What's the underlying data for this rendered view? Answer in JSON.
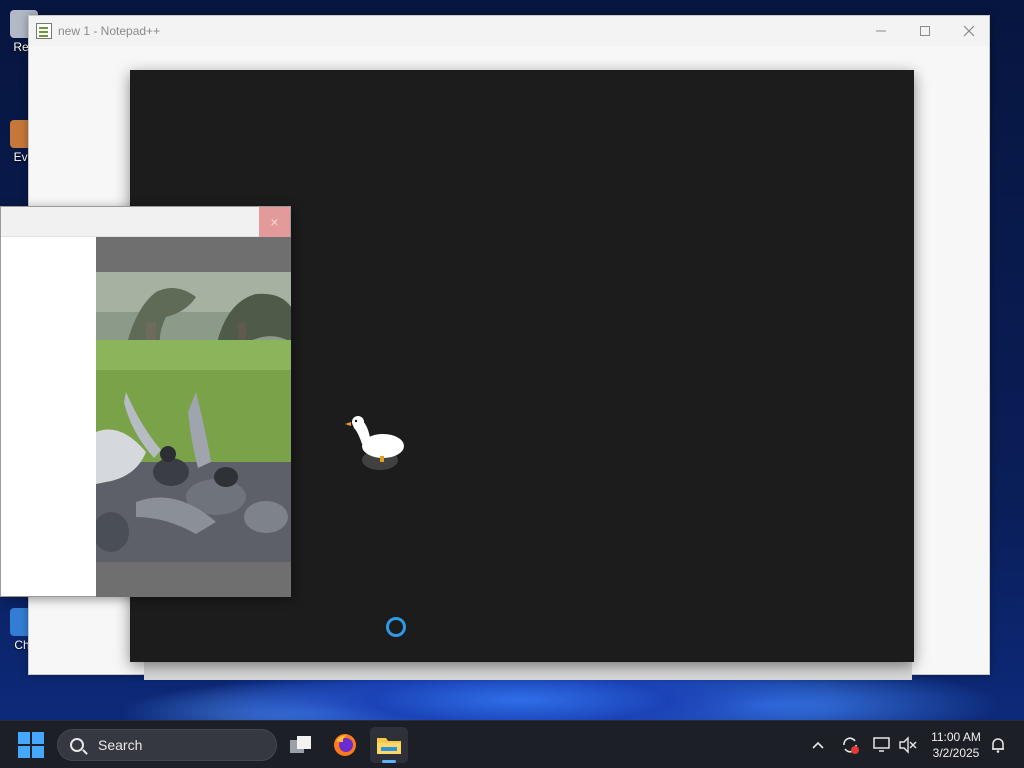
{
  "desktop": {
    "icons": [
      {
        "label": "Rec",
        "icon": "recycle-bin-icon"
      },
      {
        "label": "Eve",
        "icon": "app-shortcut-icon"
      },
      {
        "label": "Chr",
        "icon": "chrome-shortcut-icon"
      }
    ]
  },
  "notepad_window": {
    "title": "new 1 - Notepad++",
    "controls": {
      "minimize": "minimize-icon",
      "maximize": "maximize-icon",
      "close": "close-icon"
    }
  },
  "overlay_window": {
    "background": "#1c1c1c",
    "content": [
      "goose-sprite",
      "loading-spinner"
    ]
  },
  "popup_window": {
    "close_glyph": "×",
    "media": "pigeons-in-park-photo"
  },
  "taskbar": {
    "search_label": "Search",
    "apps": [
      {
        "name": "task-view",
        "icon": "task-view-icon"
      },
      {
        "name": "firefox",
        "icon": "firefox-icon"
      },
      {
        "name": "file-explorer",
        "icon": "folder-icon",
        "active": true
      }
    ],
    "tray": [
      "chevron-up-icon",
      "sync-icon",
      "network-icon",
      "volume-muted-icon"
    ],
    "clock": {
      "time": "11:00 AM",
      "date": "3/2/2025"
    },
    "notifications_icon": "notification-bell-icon"
  },
  "colors": {
    "accent": "#45a7ff",
    "taskbar": "#1d1f26",
    "close_hover": "#e39a9a"
  }
}
